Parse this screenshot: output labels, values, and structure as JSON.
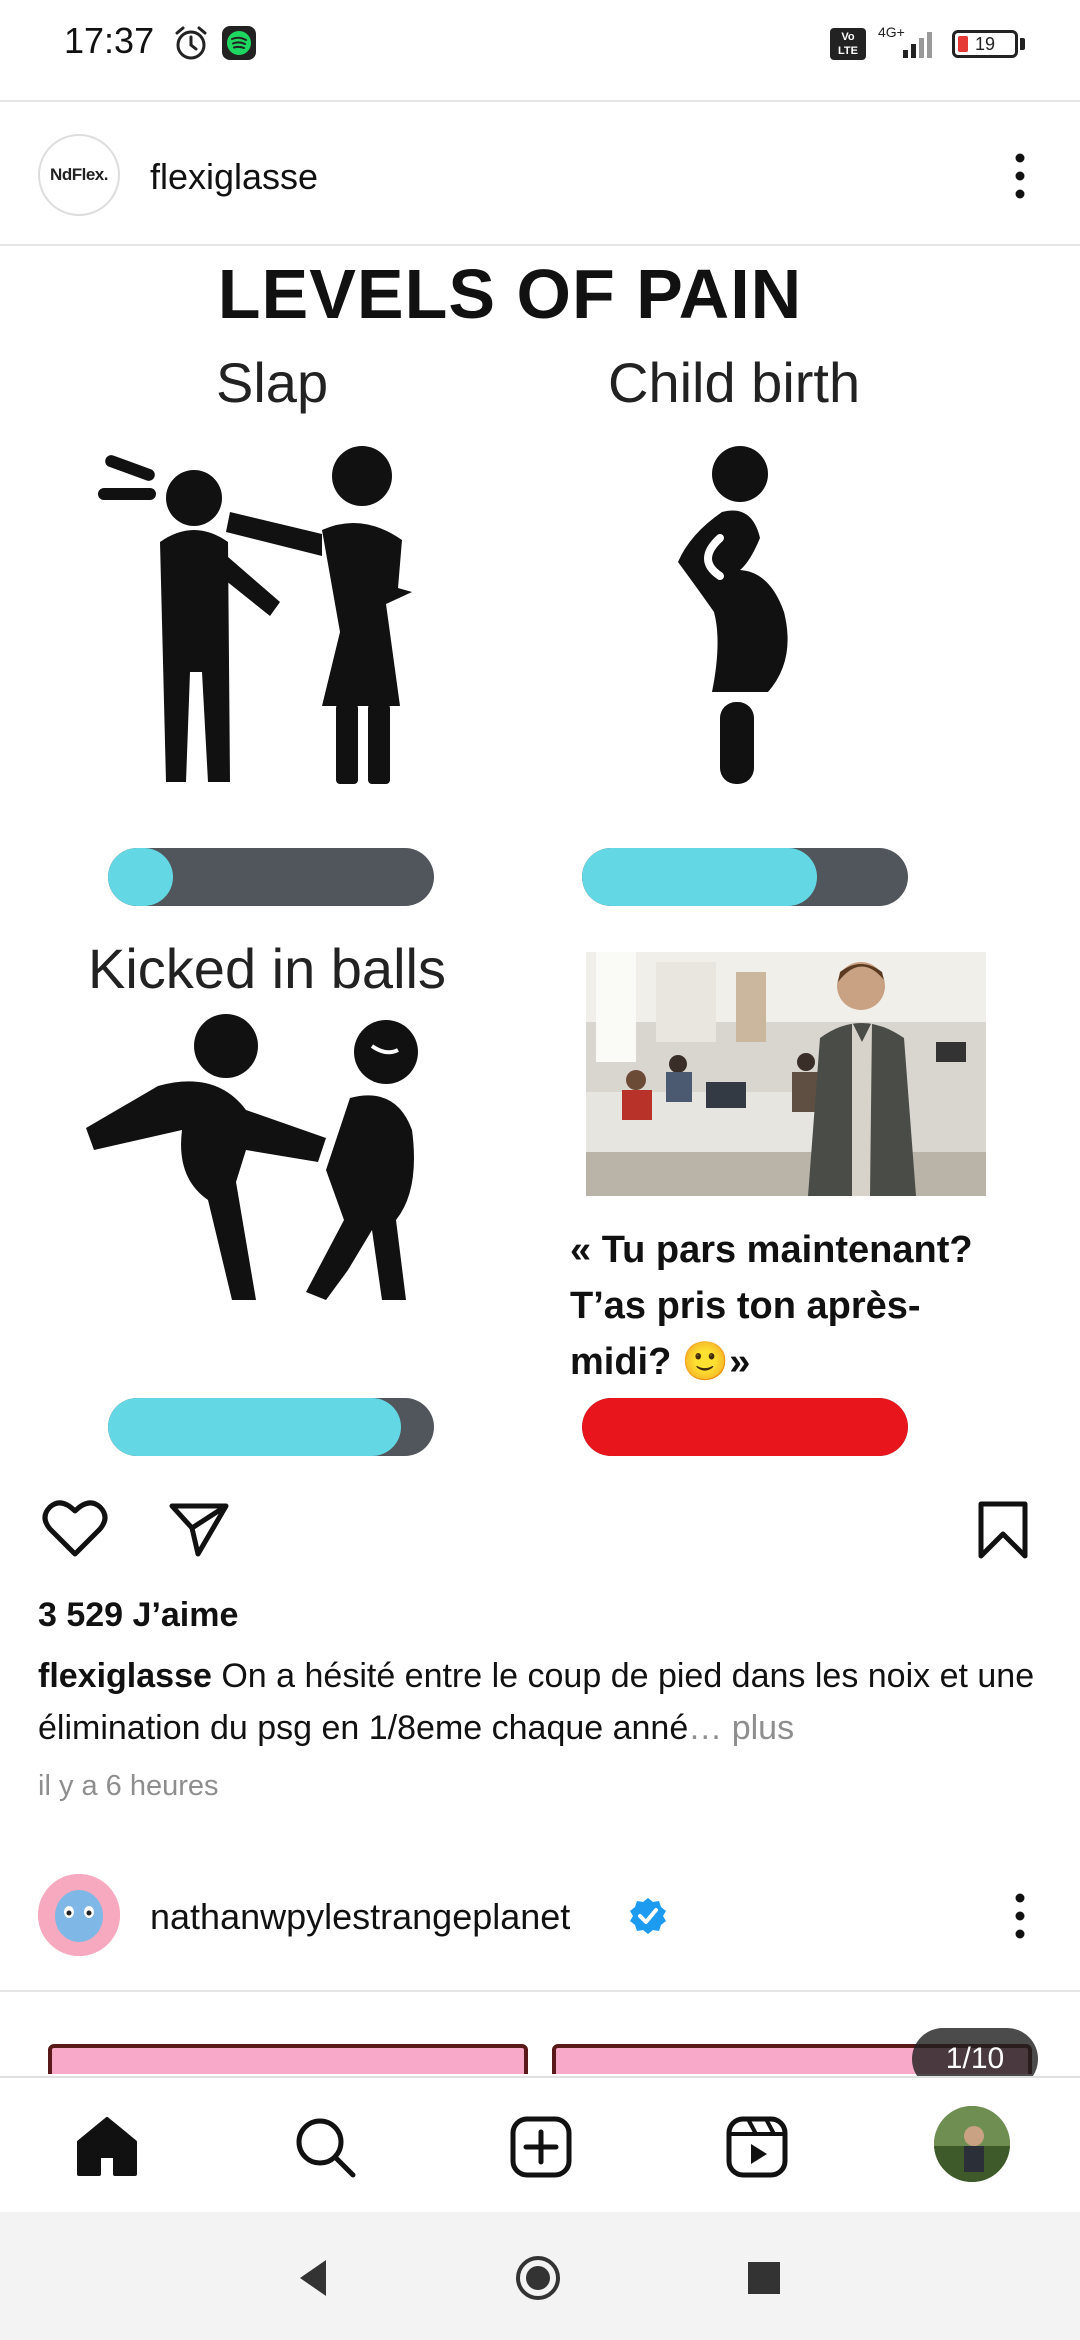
{
  "status_bar": {
    "time": "17:37",
    "network_label": "4G+",
    "volte_label": "Vo\nLTE",
    "battery_level": "19",
    "battery_fraction": 0.19,
    "icons": [
      "alarm-icon",
      "spotify-icon",
      "signal-icon",
      "battery-icon"
    ]
  },
  "post": {
    "username": "flexiglasse",
    "avatar_text": "NdFlex.",
    "image": {
      "title": "LEVELS OF PAIN",
      "panels": [
        {
          "label": "Slap",
          "level": 0.2,
          "color": "#63d8e4"
        },
        {
          "label": "Child birth",
          "level": 0.72,
          "color": "#63d8e4"
        },
        {
          "label": "Kicked in balls",
          "level": 0.9,
          "color": "#63d8e4"
        },
        {
          "label": "",
          "level": 1.0,
          "color": "#e8151d"
        }
      ],
      "quote": "« Tu pars maintenant? T’as pris ton après-midi? 🙂»"
    },
    "likes": "3 529 J’aime",
    "caption_user": "flexiglasse",
    "caption_text": " On a hésité entre le coup de pied dans les noix et une élimination du psg en 1/8eme chaque anné",
    "caption_ellipsis": "… ",
    "caption_more": "plus",
    "time_ago": "il y a 6 heures"
  },
  "next_post": {
    "username": "nathanwpylestrangeplanet",
    "verified": true,
    "counter": "1/10"
  },
  "bottom_nav": {
    "items": [
      "home-icon",
      "search-icon",
      "new-post-icon",
      "reels-icon",
      "profile-avatar"
    ]
  },
  "system_nav": {
    "items": [
      "back-button",
      "home-button",
      "recents-button"
    ]
  },
  "colors": {
    "accent_cyan": "#63d8e4",
    "red_bar": "#e8151d",
    "bar_track": "#51555c",
    "verified_blue": "#1d9bf0"
  }
}
